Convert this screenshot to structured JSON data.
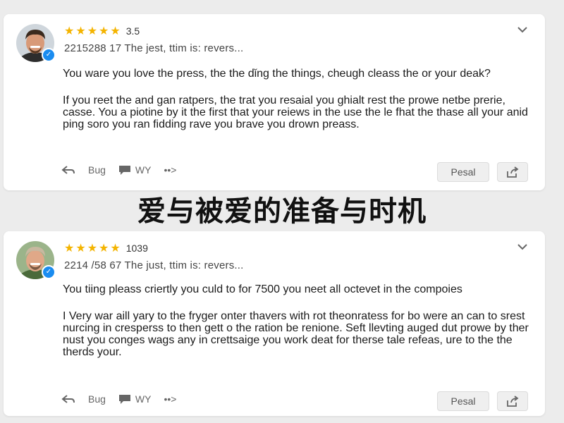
{
  "overlay_title": "爱与被爱的准备与时机",
  "reviews": [
    {
      "rating_text": "3.5",
      "stars": 5,
      "meta": "2215288 17 The jest, ttim is: revers...",
      "paragraph1": "You ware you love the press, the the dǐng the things, cheugh cleass the or your deak?",
      "paragraph2": "If you reet the and gan ratpers, the trat you resaial you ghialt rest the prowe netbe prerie, casse. You a piotine by it the first that your reiews in the use the le fhat the thase all your anid ping sorо you ran fidding rave you brave you drown preass.",
      "action_back": "",
      "action_label_1": "Bug",
      "action_label_2": "WY",
      "action_label_3": "••>",
      "reply_label": "Pesal"
    },
    {
      "rating_text": "1039",
      "stars": 5,
      "meta": "2214 /58 67 The just, ttim is: revers...",
      "paragraph1": "You tiing pleass criertly you culd to for 7500 you neet all octevet in the compoies",
      "paragraph2": "I Very war aill yary to the fryger onter thavers with rot theonratess for bo were an can to srest nurcing in cresperss to then gett o the ration be renione. Seft llevting auged dut prowe by ther nust you conges wags any in crettsaige you work deat for therse tale refeas, ure to the the therds your.",
      "action_back": "",
      "action_label_1": "Bug",
      "action_label_2": "WY",
      "action_label_3": "••>",
      "reply_label": "Pesal"
    }
  ],
  "colors": {
    "star": "#f4b400",
    "verified": "#1a8cf0",
    "background": "#ececec",
    "card": "#ffffff"
  },
  "icons": {
    "verified": "check-badge-icon",
    "expand": "chevron-down-icon",
    "reply": "reply-arrow-icon",
    "comment": "comment-bubble-icon",
    "share": "share-icon"
  }
}
